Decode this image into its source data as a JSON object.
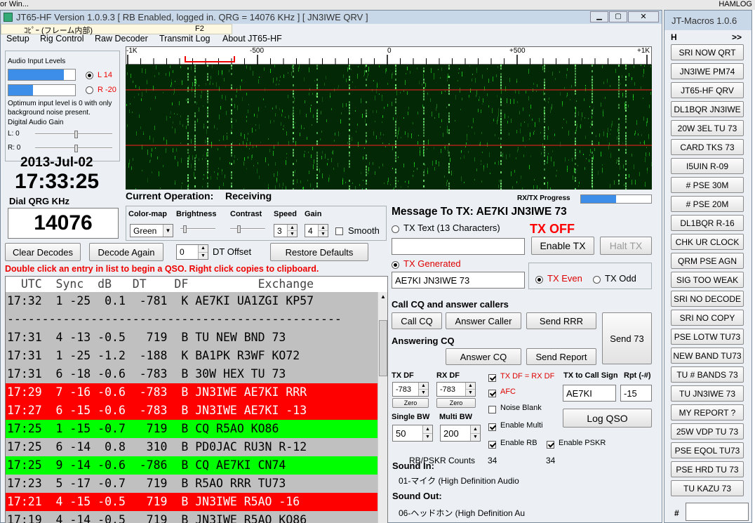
{
  "background_strip": {
    "left_text": "or Win...",
    "right_text": "HAMLOG"
  },
  "main_window": {
    "title": "JT65-HF Version 1.0.9.3  [ RB Enabled, logged in.  QRG = 14076 KHz ] [ JN3IWE QRV ]",
    "ime_text": "ｺﾋﾟｰ (フレーム内部)",
    "ime_key": "F2",
    "menu": [
      "Setup",
      "Rig Control",
      "Raw Decoder",
      "Transmit Log",
      "About JT65-HF"
    ]
  },
  "audio": {
    "title": "Audio Input Levels",
    "left_label": "L 14",
    "right_label": "R -20",
    "left_level": 0.83,
    "right_level": 0.37,
    "note": "Optimum input level is 0 with only background noise present.",
    "gain_title": "Digital Audio Gain",
    "gain_l": "L: 0",
    "gain_r": "R: 0"
  },
  "clock": {
    "date": "2013-Jul-02",
    "time": "17:33:25",
    "qrg_label": "Dial QRG KHz",
    "qrg_value": "14076"
  },
  "waterfall": {
    "scale_labels": [
      "-1K",
      "-500",
      "0",
      "+500",
      "+1K"
    ],
    "current_operation_label": "Current Operation:",
    "current_operation_value": "Receiving",
    "progress_label": "RX/TX Progress",
    "progress": 0.5
  },
  "controls": {
    "colormap_label": "Color-map",
    "colormap_value": "Green",
    "brightness_label": "Brightness",
    "contrast_label": "Contrast",
    "speed_label": "Speed",
    "speed_value": "3",
    "gain_label": "Gain",
    "gain_value": "4",
    "smooth_label": "Smooth"
  },
  "buttons": {
    "clear_decodes": "Clear Decodes",
    "decode_again": "Decode Again",
    "dt_offset_value": "0",
    "dt_offset_label": "DT Offset",
    "restore_defaults": "Restore Defaults"
  },
  "hint": "Double click an entry in list to begin a QSO.  Right click copies to clipboard.",
  "decode_header": "  UTC  Sync  dB   DT    DF          Exchange",
  "decodes": [
    {
      "text": "17:32  1 -25  0.1  -781  K AE7KI UA1ZGI KP57",
      "bg": "#c0c0c0"
    },
    {
      "text": "------------------------------------------------",
      "bg": "#c0c0c0"
    },
    {
      "text": "17:31  4 -13 -0.5   719  B TU NEW BND 73",
      "bg": "#c0c0c0"
    },
    {
      "text": "17:31  1 -25 -1.2  -188  K BA1PK R3WF KO72",
      "bg": "#c0c0c0"
    },
    {
      "text": "17:31  6 -18 -0.6  -783  B 30W HEX TU 73",
      "bg": "#c0c0c0"
    },
    {
      "text": "17:29  7 -16 -0.6  -783  B JN3IWE AE7KI RRR",
      "bg": "#ff0000",
      "fg": "#ffffff"
    },
    {
      "text": "17:27  6 -15 -0.6  -783  B JN3IWE AE7KI -13",
      "bg": "#ff0000",
      "fg": "#ffffff"
    },
    {
      "text": "17:25  1 -15 -0.7   719  B CQ R5AO KO86",
      "bg": "#00ff00"
    },
    {
      "text": "17:25  6 -14  0.8   310  B PD0JAC RU3N R-12",
      "bg": "#c0c0c0"
    },
    {
      "text": "17:25  9 -14 -0.6  -786  B CQ AE7KI CN74",
      "bg": "#00ff00"
    },
    {
      "text": "17:23  5 -17 -0.7   719  B R5AO RRR TU73",
      "bg": "#c0c0c0"
    },
    {
      "text": "17:21  4 -15 -0.5   719  B JN3IWE R5AO -16",
      "bg": "#ff0000",
      "fg": "#ffffff"
    },
    {
      "text": "17:19  4 -14 -0.5   719  B JN3IWE R5AO KO86",
      "bg": "#c0c0c0"
    }
  ],
  "tx": {
    "message_label": "Message To TX: AE7KI JN3IWE 73",
    "tx_text_label": "TX Text (13 Characters)",
    "tx_off": "TX OFF",
    "tx_text_value": "",
    "enable_tx": "Enable TX",
    "halt_tx": "Halt TX",
    "tx_generated_label": "TX Generated",
    "tx_generated_value": "AE7KI JN3IWE 73",
    "tx_even": "TX Even",
    "tx_odd": "TX Odd",
    "call_cq_title": "Call CQ and answer callers",
    "call_cq": "Call CQ",
    "answer_caller": "Answer Caller",
    "send_rrr": "Send RRR",
    "send_73": "Send 73",
    "answering_cq_title": "Answering CQ",
    "answer_cq": "Answer CQ",
    "send_report": "Send Report",
    "tx_df_label": "TX DF",
    "tx_df_value": "-783",
    "rx_df_label": "RX DF",
    "rx_df_value": "-783",
    "zero": "Zero",
    "txdf_eq_rxdf": "TX DF = RX DF",
    "afc": "AFC",
    "noise_blank": "Noise Blank",
    "enable_multi": "Enable Multi",
    "to_call_label": "TX to Call Sign",
    "to_call_value": "AE7KI",
    "rpt_label": "Rpt (-#)",
    "rpt_value": "-15",
    "single_bw_label": "Single BW",
    "single_bw_value": "50",
    "multi_bw_label": "Multi BW",
    "multi_bw_value": "200",
    "log_qso": "Log QSO",
    "enable_rb": "Enable RB",
    "enable_pskr": "Enable PSKR",
    "rb_counts_label": "RB/PSKR Counts",
    "rb_count": "34",
    "pskr_count": "34",
    "sound_in_label": "Sound In:",
    "sound_in_value": "01-マイク (High Definition Audio",
    "sound_out_label": "Sound Out:",
    "sound_out_value": "06-ヘッドホン (High Definition Au"
  },
  "macros": {
    "title": "JT-Macros 1.0.6",
    "h_label": "H",
    "more_label": ">>",
    "items": [
      "SRI NOW QRT",
      "JN3IWE PM74",
      "JT65-HF QRV",
      "DL1BQR JN3IWE",
      "20W 3EL TU 73",
      "CARD TKS 73",
      "I5UIN R-09",
      "# PSE 30M",
      "# PSE 20M",
      "DL1BQR R-16",
      "CHK UR CLOCK",
      "QRM PSE AGN",
      "SIG TOO WEAK",
      "SRI NO DECODE",
      "SRI NO COPY",
      "PSE LOTW TU73",
      "NEW BAND TU73",
      "TU # BANDS 73",
      "TU JN3IWE 73",
      "MY REPORT ?",
      "25W VDP TU 73",
      "PSE EQOL TU73",
      "PSE HRD TU 73",
      "TU KAZU 73"
    ],
    "hash_label": "#"
  }
}
